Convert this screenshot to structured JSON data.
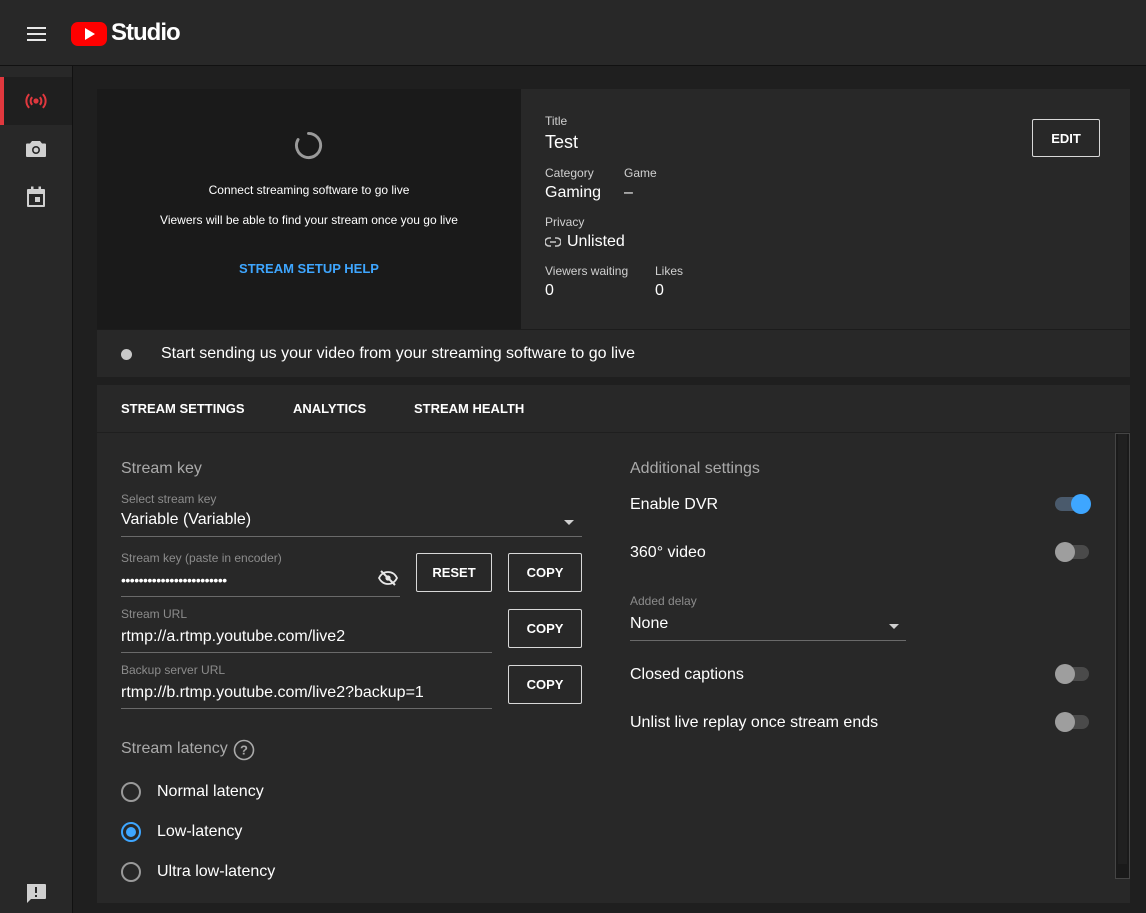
{
  "header": {
    "logo_text": "Studio",
    "menu_icon": "hamburger-menu-icon",
    "brand_color": "#ff0000"
  },
  "sidebar": {
    "items": [
      {
        "icon": "live-broadcast-icon",
        "active": true
      },
      {
        "icon": "camera-icon",
        "active": false
      },
      {
        "icon": "calendar-icon",
        "active": false
      }
    ],
    "feedback_icon": "feedback-icon",
    "accent_color": "#e0383e"
  },
  "preview": {
    "message_line1": "Connect streaming software to go live",
    "message_line2": "Viewers will be able to find your stream once you go live",
    "help_link": "STREAM SETUP HELP"
  },
  "details": {
    "title_label": "Title",
    "title_value": "Test",
    "category_label": "Category",
    "category_value": "Gaming",
    "game_label": "Game",
    "game_value": "–",
    "privacy_label": "Privacy",
    "privacy_value": "Unlisted",
    "viewers_label": "Viewers waiting",
    "viewers_value": "0",
    "likes_label": "Likes",
    "likes_value": "0",
    "edit_label": "EDIT"
  },
  "status": {
    "text": "Start sending us your video from your streaming software to go live"
  },
  "tabs": [
    "STREAM SETTINGS",
    "ANALYTICS",
    "STREAM HEALTH"
  ],
  "stream_key": {
    "section_title": "Stream key",
    "select_label": "Select stream key",
    "select_value": "Variable (Variable)",
    "key_label": "Stream key (paste in encoder)",
    "key_value": "••••••••••••••••••••••••",
    "reset_label": "RESET",
    "copy_label": "COPY",
    "url_label": "Stream URL",
    "url_value": "rtmp://a.rtmp.youtube.com/live2",
    "backup_label": "Backup server URL",
    "backup_value": "rtmp://b.rtmp.youtube.com/live2?backup=1"
  },
  "latency": {
    "section_title": "Stream latency",
    "options": [
      {
        "label": "Normal latency",
        "checked": false
      },
      {
        "label": "Low-latency",
        "checked": true
      },
      {
        "label": "Ultra low-latency",
        "checked": false
      }
    ]
  },
  "additional": {
    "section_title": "Additional settings",
    "dvr_label": "Enable DVR",
    "dvr_on": true,
    "video360_label": "360° video",
    "video360_on": false,
    "delay_label": "Added delay",
    "delay_value": "None",
    "captions_label": "Closed captions",
    "captions_on": false,
    "unlist_label": "Unlist live replay once stream ends",
    "unlist_on": false
  }
}
